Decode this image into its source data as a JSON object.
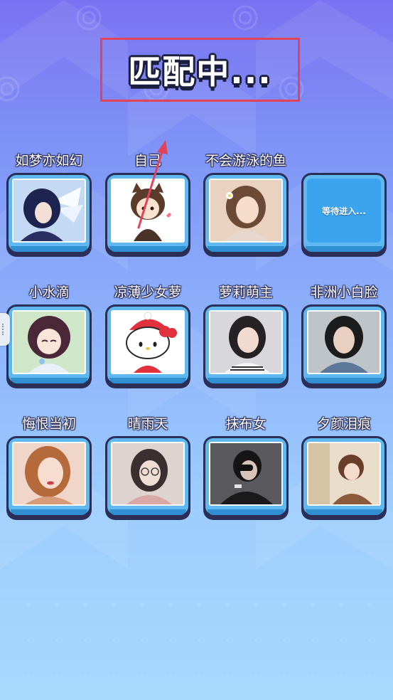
{
  "title": "匹配中...",
  "waiting_label": "等待进入...",
  "colors": {
    "title_box_border": "#e0435a",
    "annotation_arrow": "#e0435a",
    "card_frame": "#2b2f57",
    "card_fill": "#5fb8ef",
    "waiting_fill": "#3aa4ee"
  },
  "players": [
    {
      "name": "如梦亦如幻",
      "avatar": "winged-girl-avatar",
      "status": "joined"
    },
    {
      "name": "自己",
      "avatar": "cat-ear-cartoon-girl-avatar",
      "status": "joined"
    },
    {
      "name": "不会游泳的鱼",
      "avatar": "girl-with-flower-photo-avatar",
      "status": "joined"
    },
    {
      "name": "",
      "avatar": "",
      "status": "waiting"
    },
    {
      "name": "小水滴",
      "avatar": "anime-girl-avatar",
      "status": "joined"
    },
    {
      "name": "凉薄少女萝",
      "avatar": "hello-kitty-avatar",
      "status": "joined"
    },
    {
      "name": "萝莉萌主",
      "avatar": "girl-selfie-photo-avatar",
      "status": "joined"
    },
    {
      "name": "非洲小白脸",
      "avatar": "stylized-girl-avatar",
      "status": "joined"
    },
    {
      "name": "悔恨当初",
      "avatar": "illustrated-woman-avatar",
      "status": "joined"
    },
    {
      "name": "晴雨天",
      "avatar": "glasses-girl-photo-avatar",
      "status": "joined"
    },
    {
      "name": "抹布女",
      "avatar": "guy-covering-face-photo-avatar",
      "status": "joined"
    },
    {
      "name": "夕颜泪痕",
      "avatar": "anime-boy-avatar",
      "status": "joined"
    }
  ]
}
